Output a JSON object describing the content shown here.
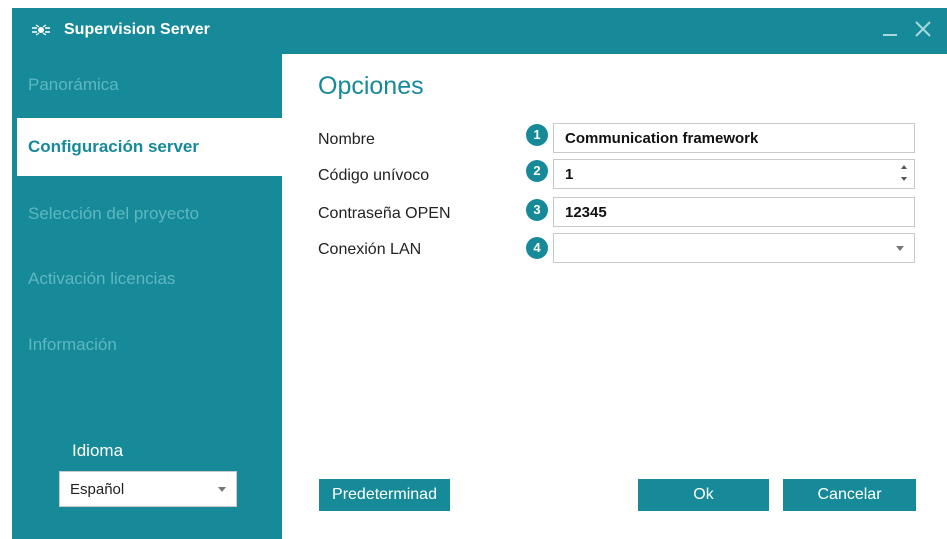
{
  "window": {
    "title": "Supervision Server"
  },
  "sidebar": {
    "items": [
      {
        "label": "Panorámica",
        "active": false
      },
      {
        "label": "Configuración server",
        "active": true
      },
      {
        "label": "Selección del proyecto",
        "active": false
      },
      {
        "label": "Activación licencias",
        "active": false
      },
      {
        "label": "Información",
        "active": false
      }
    ],
    "language_label": "Idioma",
    "language_value": "Español"
  },
  "options": {
    "title": "Opciones",
    "fields": [
      {
        "badge": "1",
        "label": "Nombre",
        "value": "Communication framework",
        "kind": "text"
      },
      {
        "badge": "2",
        "label": "Código unívoco",
        "value": "1",
        "kind": "spinner"
      },
      {
        "badge": "3",
        "label": "Contraseña OPEN",
        "value": "12345",
        "kind": "text"
      },
      {
        "badge": "4",
        "label": "Conexión LAN",
        "value": "",
        "kind": "dropdown"
      }
    ]
  },
  "buttons": {
    "default": "Predeterminad",
    "ok": "Ok",
    "cancel": "Cancelar"
  },
  "colors": {
    "accent": "#168a98",
    "inactive_nav": "#5fb7c0"
  }
}
